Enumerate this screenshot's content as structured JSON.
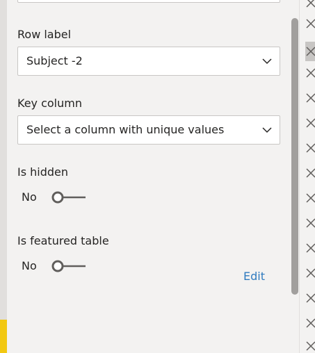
{
  "fields": {
    "row_label": {
      "label": "Row label",
      "value": "Subject -2"
    },
    "key_column": {
      "label": "Key column",
      "value": "Select a column with unique values"
    }
  },
  "toggles": {
    "is_hidden": {
      "label": "Is hidden",
      "state": "No"
    },
    "is_featured": {
      "label": "Is featured table",
      "state": "No"
    }
  },
  "edit_label": "Edit",
  "icons": {
    "dropdown": "chevron-down-icon",
    "toggle": "toggle-off-icon",
    "close": "close-icon"
  },
  "colors": {
    "accent": "#f2c811",
    "link": "#2f7bbf",
    "panel_bg": "#f3f2f1"
  }
}
